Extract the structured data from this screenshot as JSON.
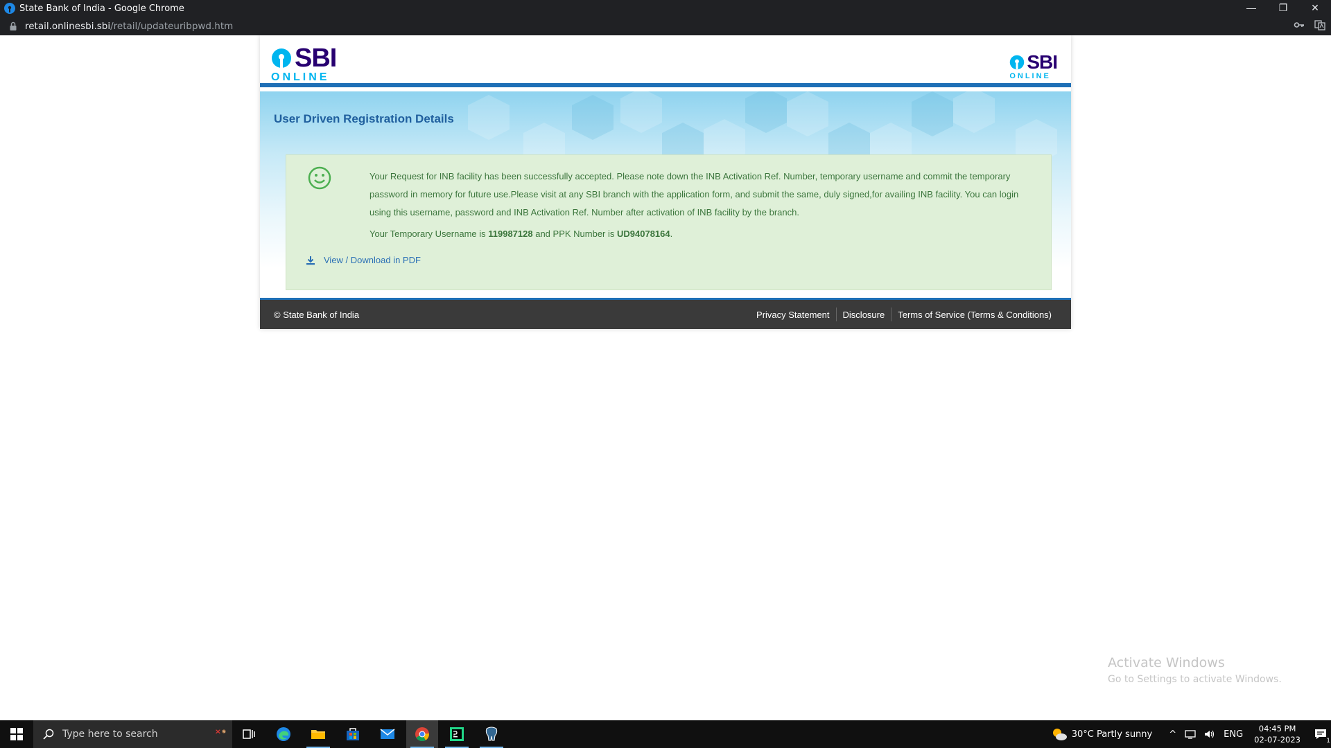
{
  "window": {
    "title": "State Bank of India - Google Chrome",
    "url_host": "retail.onlinesbi.sbi",
    "url_path": "/retail/updateuribpwd.htm",
    "controls": {
      "minimize": "—",
      "restore": "❐",
      "close": "✕"
    }
  },
  "header": {
    "logo_left": {
      "sbi": "SBI",
      "online": "ONLINE"
    },
    "logo_right": {
      "sbi": "SBI",
      "online": "ONLINE"
    }
  },
  "main": {
    "page_title": "User Driven Registration Details",
    "message": "Your Request for INB facility has been successfully accepted. Please note down the INB Activation Ref. Number, temporary username and commit the temporary password in memory for future use.Please visit at any SBI branch with the application form, and submit the same, duly signed,for availing INB facility. You can login using this username, password and INB Activation Ref. Number after activation of INB facility by the branch.",
    "username_prefix": "Your Temporary Username is ",
    "username": "119987128",
    "ppk_prefix": " and PPK Number is ",
    "ppk": "UD94078164",
    "ppk_suffix": ".",
    "pdf_link": "View / Download in PDF"
  },
  "footer": {
    "copyright": "© State Bank of India",
    "links": [
      "Privacy Statement",
      "Disclosure",
      "Terms of Service (Terms & Conditions)"
    ]
  },
  "watermark": {
    "line1": "Activate Windows",
    "line2": "Go to Settings to activate Windows."
  },
  "taskbar": {
    "search_placeholder": "Type here to search",
    "weather": "30°C  Partly sunny",
    "language": "ENG",
    "time": "04:45 PM",
    "date": "02-07-2023",
    "notification_count": "1"
  },
  "colors": {
    "sbi_blue": "#280071",
    "sbi_cyan": "#00b5ef",
    "header_bar": "#1e6fb6",
    "success_bg": "#dff0d8",
    "success_text": "#3c763d"
  }
}
